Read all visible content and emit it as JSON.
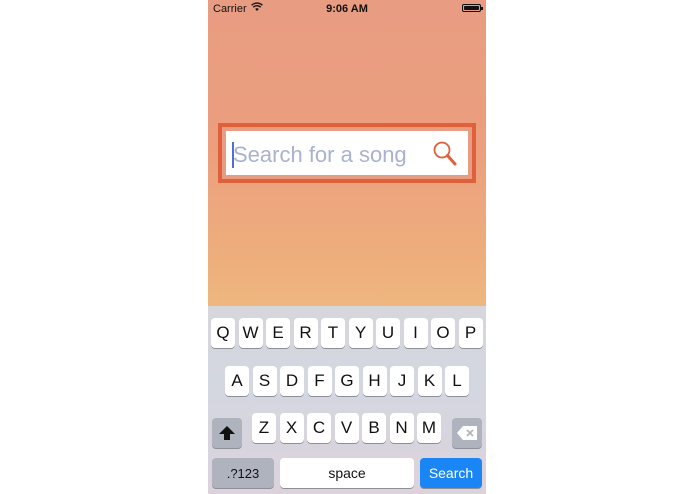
{
  "status_bar": {
    "carrier": "Carrier",
    "time": "9:06 AM"
  },
  "search": {
    "placeholder": "Search for a song",
    "value": ""
  },
  "keyboard": {
    "row1": [
      "Q",
      "W",
      "E",
      "R",
      "T",
      "Y",
      "U",
      "I",
      "O",
      "P"
    ],
    "row2": [
      "A",
      "S",
      "D",
      "F",
      "G",
      "H",
      "J",
      "K",
      "L"
    ],
    "row3": [
      "Z",
      "X",
      "C",
      "V",
      "B",
      "N",
      "M"
    ],
    "numbers_label": ".?123",
    "space_label": "space",
    "search_label": "Search"
  },
  "colors": {
    "accent": "#e0603b",
    "search_key": "#1a86f5"
  }
}
